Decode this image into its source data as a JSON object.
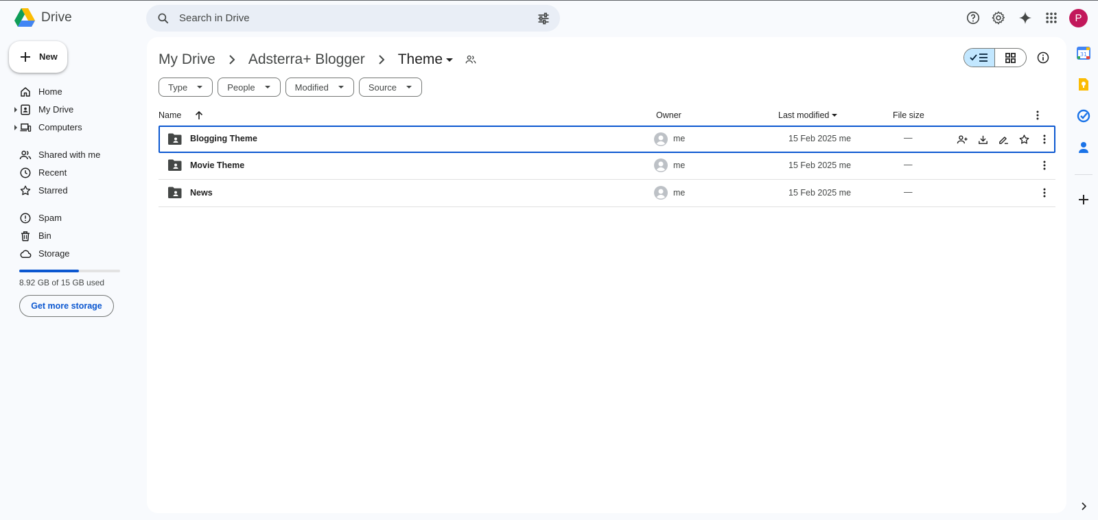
{
  "app": {
    "name": "Drive",
    "avatar_letter": "P",
    "avatar_color": "#c2185b",
    "accent": "#0b57d0"
  },
  "search": {
    "placeholder": "Search in Drive"
  },
  "sidebar": {
    "new_label": "New",
    "items": [
      {
        "label": "Home",
        "icon": "home-icon"
      },
      {
        "label": "My Drive",
        "icon": "my-drive-icon"
      },
      {
        "label": "Computers",
        "icon": "computers-icon"
      },
      {
        "label": "Shared with me",
        "icon": "shared-icon"
      },
      {
        "label": "Recent",
        "icon": "clock-icon"
      },
      {
        "label": "Starred",
        "icon": "star-icon"
      },
      {
        "label": "Spam",
        "icon": "spam-icon"
      },
      {
        "label": "Bin",
        "icon": "bin-icon"
      },
      {
        "label": "Storage",
        "icon": "cloud-icon"
      }
    ],
    "storage_used_fraction": 0.595,
    "storage_text": "8.92 GB of 15 GB used",
    "get_storage_label": "Get more storage"
  },
  "breadcrumb": {
    "items": [
      "My Drive",
      "Adsterra+ Blogger",
      "Theme"
    ]
  },
  "filters": [
    "Type",
    "People",
    "Modified",
    "Source"
  ],
  "table": {
    "columns": {
      "name": "Name",
      "owner": "Owner",
      "modified": "Last modified",
      "size": "File size"
    },
    "rows": [
      {
        "name": "Blogging Theme",
        "owner": "me",
        "modified": "15 Feb 2025 me",
        "size": "—"
      },
      {
        "name": "Movie Theme",
        "owner": "me",
        "modified": "15 Feb 2025 me",
        "size": "—"
      },
      {
        "name": "News",
        "owner": "me",
        "modified": "15 Feb 2025 me",
        "size": "—"
      }
    ]
  }
}
